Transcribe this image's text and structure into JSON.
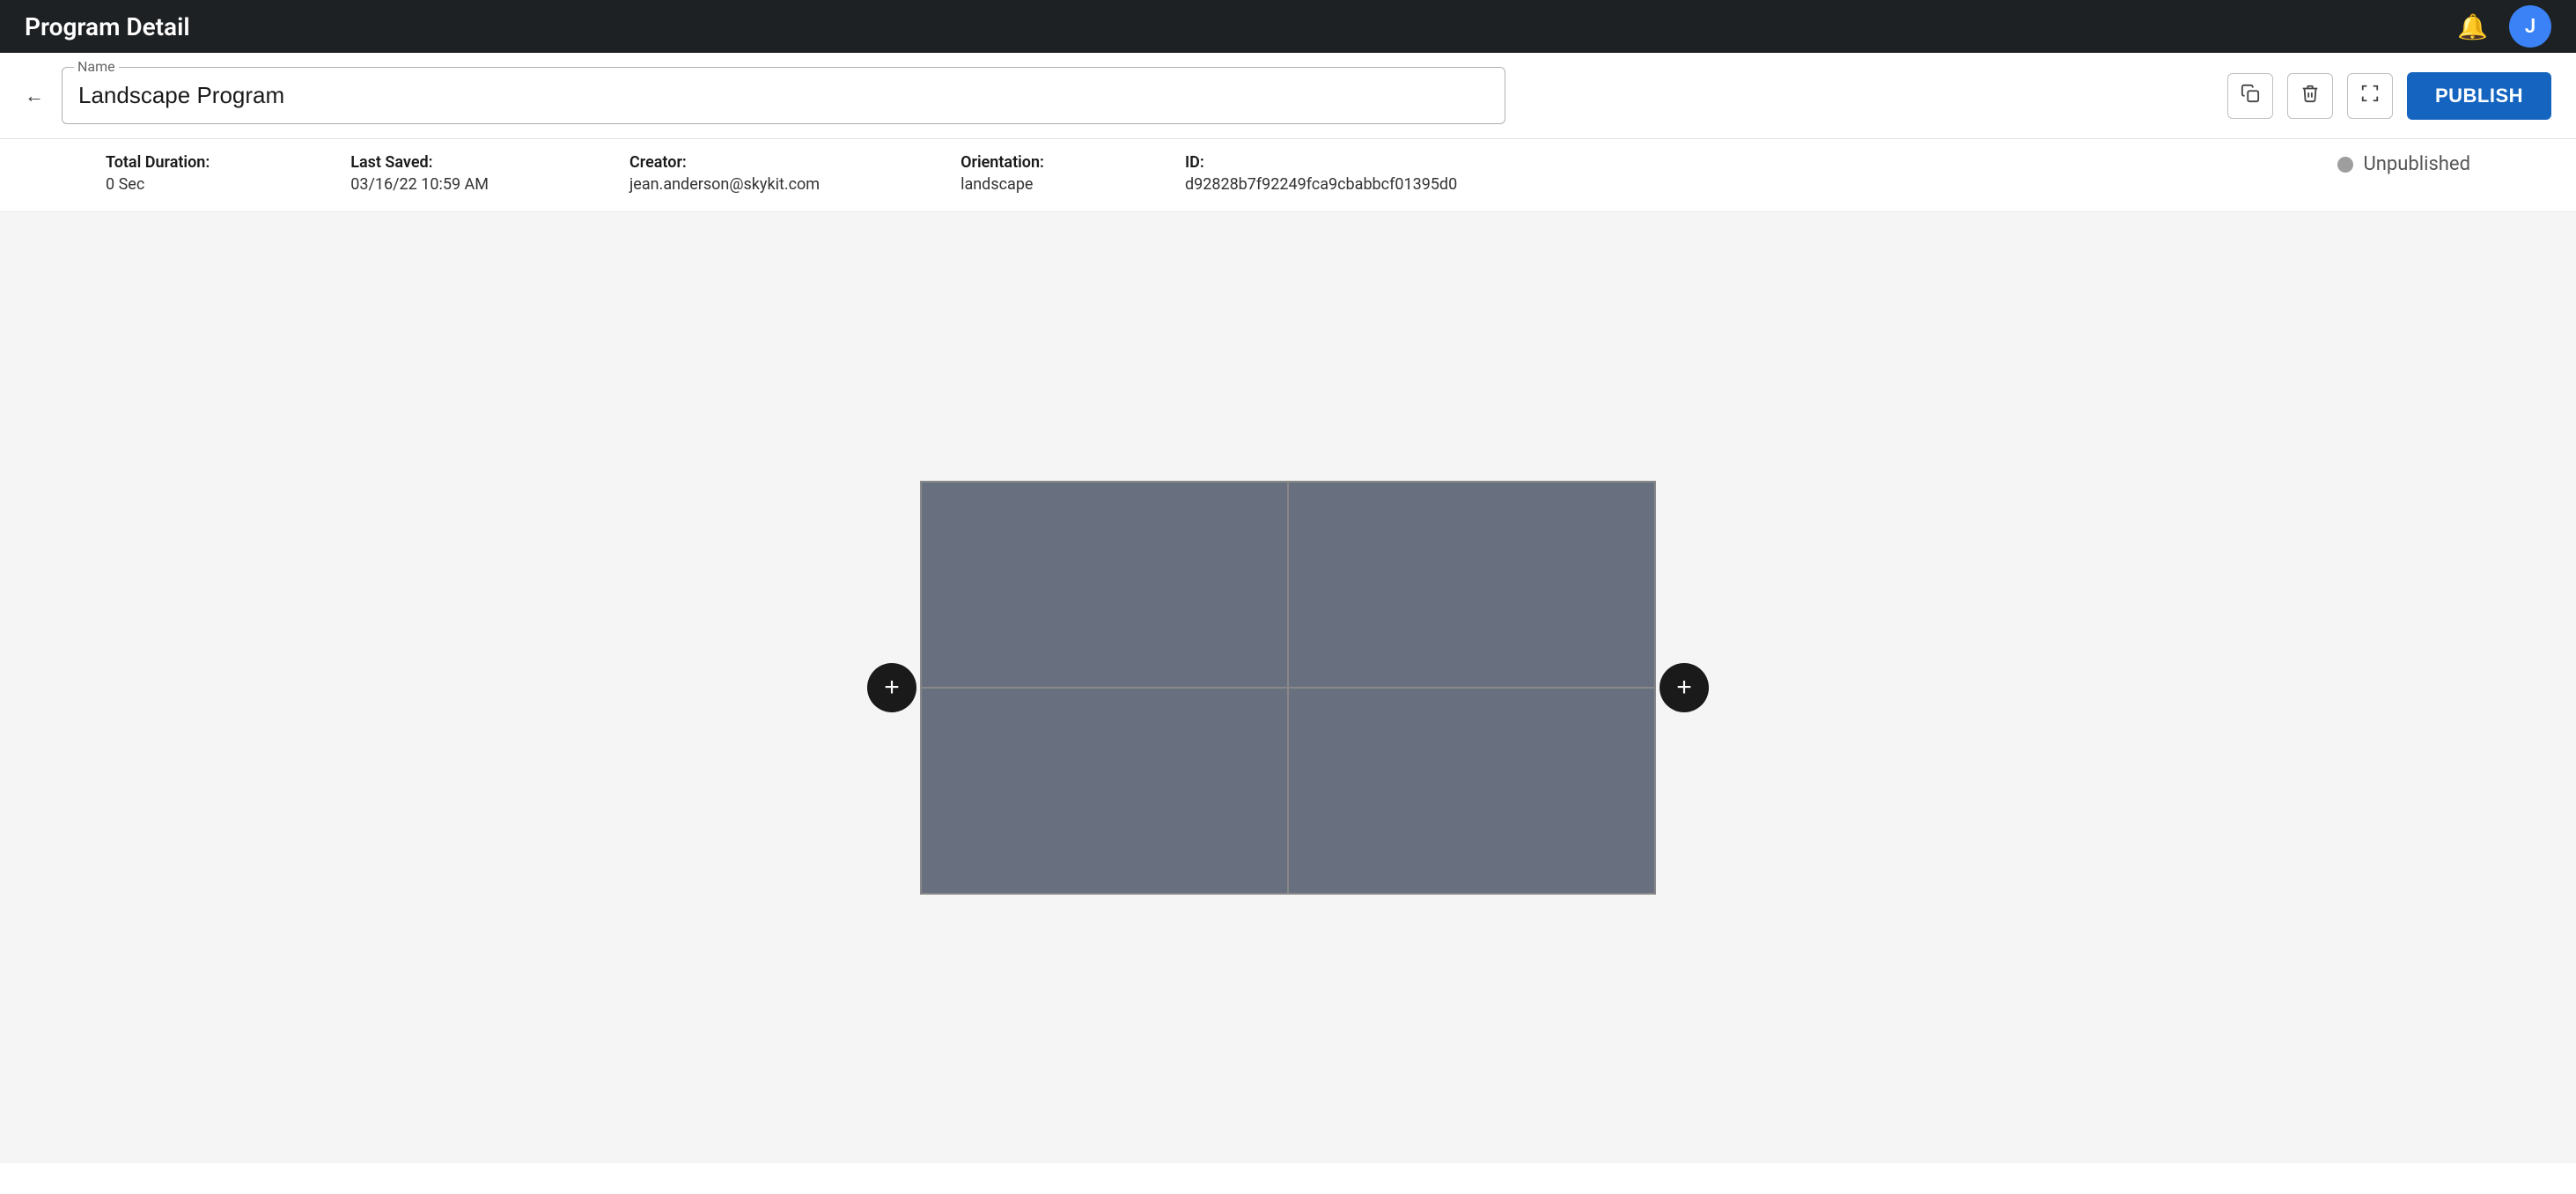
{
  "header": {
    "title": "Program Detail",
    "bell_label": "🔔",
    "avatar_initial": "J"
  },
  "toolbar": {
    "back_label": "←",
    "name_field_label": "Name",
    "name_field_value": "Landscape Program",
    "copy_icon": "⧉",
    "delete_icon": "🗑",
    "fullscreen_icon": "⛶",
    "publish_label": "PUBLISH"
  },
  "meta": {
    "total_duration_label": "Total Duration:",
    "total_duration_value": "0 Sec",
    "last_saved_label": "Last Saved:",
    "last_saved_value": "03/16/22 10:59 AM",
    "creator_label": "Creator:",
    "creator_value": "jean.anderson@skykit.com",
    "orientation_label": "Orientation:",
    "orientation_value": "landscape",
    "id_label": "ID:",
    "id_value": "d92828b7f92249fca9cbabbcf01395d0",
    "status_label": "Unpublished"
  },
  "canvas": {
    "add_left_label": "+",
    "add_right_label": "+",
    "grid_cells": [
      {
        "id": "cell-top-left"
      },
      {
        "id": "cell-top-right"
      },
      {
        "id": "cell-bottom-left"
      },
      {
        "id": "cell-bottom-right"
      }
    ]
  }
}
